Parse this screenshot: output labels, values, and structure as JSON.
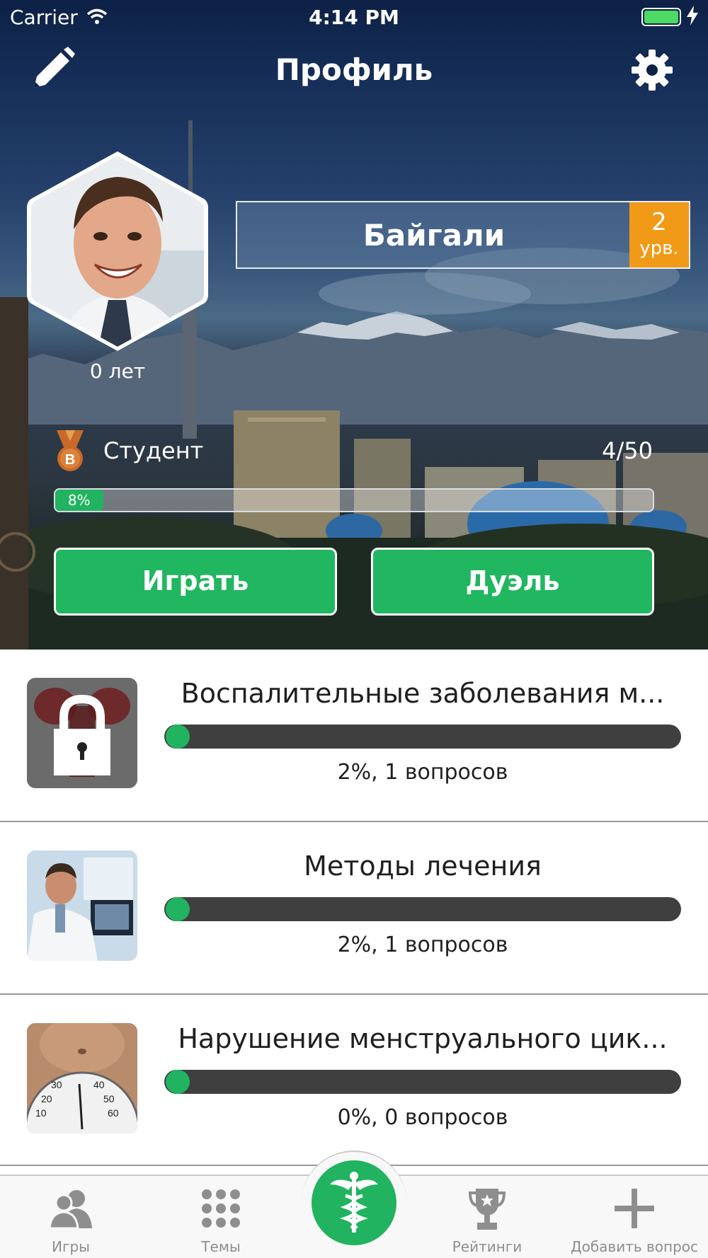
{
  "status_bar": {
    "carrier": "Carrier",
    "time": "4:14 PM",
    "icons": [
      "wifi-icon",
      "battery-icon",
      "charging-bolt-icon"
    ]
  },
  "nav": {
    "title": "Профиль",
    "left_icon": "pencil-icon",
    "right_icon": "gear-icon"
  },
  "profile": {
    "name": "Байгали",
    "level": "2",
    "level_unit": "урв.",
    "age": "0 лет",
    "rank": "Студент",
    "rank_badge_letter": "B",
    "rank_count": "4/50",
    "progress_label": "8%",
    "progress_fraction": 0.08
  },
  "actions": {
    "play": "Играть",
    "duel": "Дуэль"
  },
  "topics": [
    {
      "title": "Воспалительные заболевания м...",
      "stats": "2%, 1 вопросов",
      "progress": 0.02,
      "locked": true,
      "thumb": "lock-icon"
    },
    {
      "title": "Методы лечения",
      "stats": "2%, 1 вопросов",
      "progress": 0.02,
      "locked": false,
      "thumb": "doctor-photo"
    },
    {
      "title": "Нарушение менструального цик...",
      "stats": "0%, 0 вопросов",
      "progress": 0.0,
      "locked": false,
      "thumb": "scale-photo"
    }
  ],
  "tabbar": {
    "tabs": [
      {
        "label": "Игры",
        "icon": "users-icon"
      },
      {
        "label": "Темы",
        "icon": "grid-dots-icon"
      },
      {
        "label": "",
        "icon": "caduceus-icon"
      },
      {
        "label": "Рейтинги",
        "icon": "trophy-icon"
      },
      {
        "label": "Добавить вопрос",
        "icon": "plus-icon"
      }
    ]
  },
  "colors": {
    "accent_green": "#21b35f",
    "level_orange": "#f19a18",
    "track_dark": "#3f3f3f",
    "tab_gray": "#8e8e8e"
  }
}
